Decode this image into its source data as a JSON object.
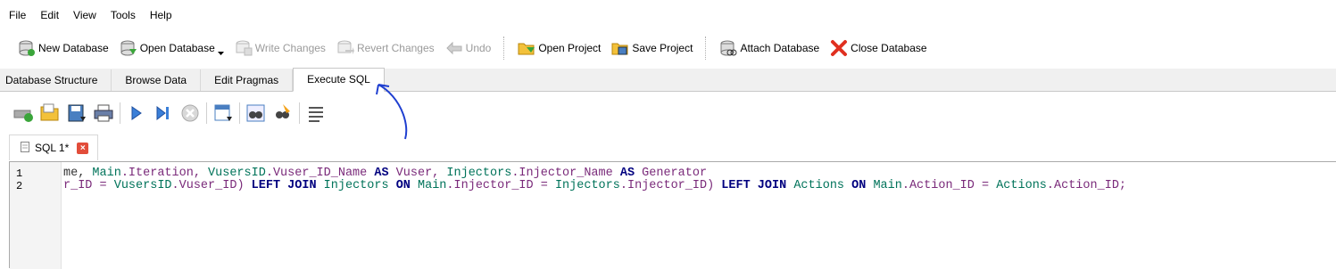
{
  "menu": [
    "File",
    "Edit",
    "View",
    "Tools",
    "Help"
  ],
  "toolbar": {
    "new_database": "New Database",
    "open_database": "Open Database",
    "write_changes": "Write Changes",
    "revert_changes": "Revert Changes",
    "undo": "Undo",
    "open_project": "Open Project",
    "save_project": "Save Project",
    "attach_database": "Attach Database",
    "close_database": "Close Database"
  },
  "tabs": [
    "Database Structure",
    "Browse Data",
    "Edit Pragmas",
    "Execute SQL"
  ],
  "active_tab": "Execute SQL",
  "sql_tab": {
    "label": "SQL 1*",
    "close": "×"
  },
  "editor": {
    "line_numbers": [
      "1",
      "2"
    ],
    "line1": [
      {
        "t": "me, ",
        "c": "plain"
      },
      {
        "t": "Main",
        "c": "ident"
      },
      {
        "t": ".Iteration, ",
        "c": "col"
      },
      {
        "t": "VusersID",
        "c": "ident"
      },
      {
        "t": ".Vuser_ID_Name ",
        "c": "col"
      },
      {
        "t": "AS",
        "c": "kw"
      },
      {
        "t": " Vuser, ",
        "c": "col"
      },
      {
        "t": "Injectors",
        "c": "ident"
      },
      {
        "t": ".Injector_Name ",
        "c": "col"
      },
      {
        "t": "AS",
        "c": "kw"
      },
      {
        "t": " Generator",
        "c": "col"
      }
    ],
    "line2": [
      {
        "t": "r_ID = ",
        "c": "col"
      },
      {
        "t": "VusersID",
        "c": "ident"
      },
      {
        "t": ".Vuser_ID) ",
        "c": "col"
      },
      {
        "t": "LEFT JOIN",
        "c": "kw"
      },
      {
        "t": " Injectors ",
        "c": "ident"
      },
      {
        "t": "ON",
        "c": "kw"
      },
      {
        "t": " Main",
        "c": "ident"
      },
      {
        "t": ".Injector_ID = ",
        "c": "col"
      },
      {
        "t": "Injectors",
        "c": "ident"
      },
      {
        "t": ".Injector_ID) ",
        "c": "col"
      },
      {
        "t": "LEFT JOIN",
        "c": "kw"
      },
      {
        "t": " Actions ",
        "c": "ident"
      },
      {
        "t": "ON",
        "c": "kw"
      },
      {
        "t": " Main",
        "c": "ident"
      },
      {
        "t": ".Action_ID = ",
        "c": "col"
      },
      {
        "t": "Actions",
        "c": "ident"
      },
      {
        "t": ".Action_ID;",
        "c": "col"
      }
    ]
  },
  "colors": {
    "accent": "#1f3fd0",
    "close_red": "#e24d3a",
    "keyword": "#00007f"
  }
}
